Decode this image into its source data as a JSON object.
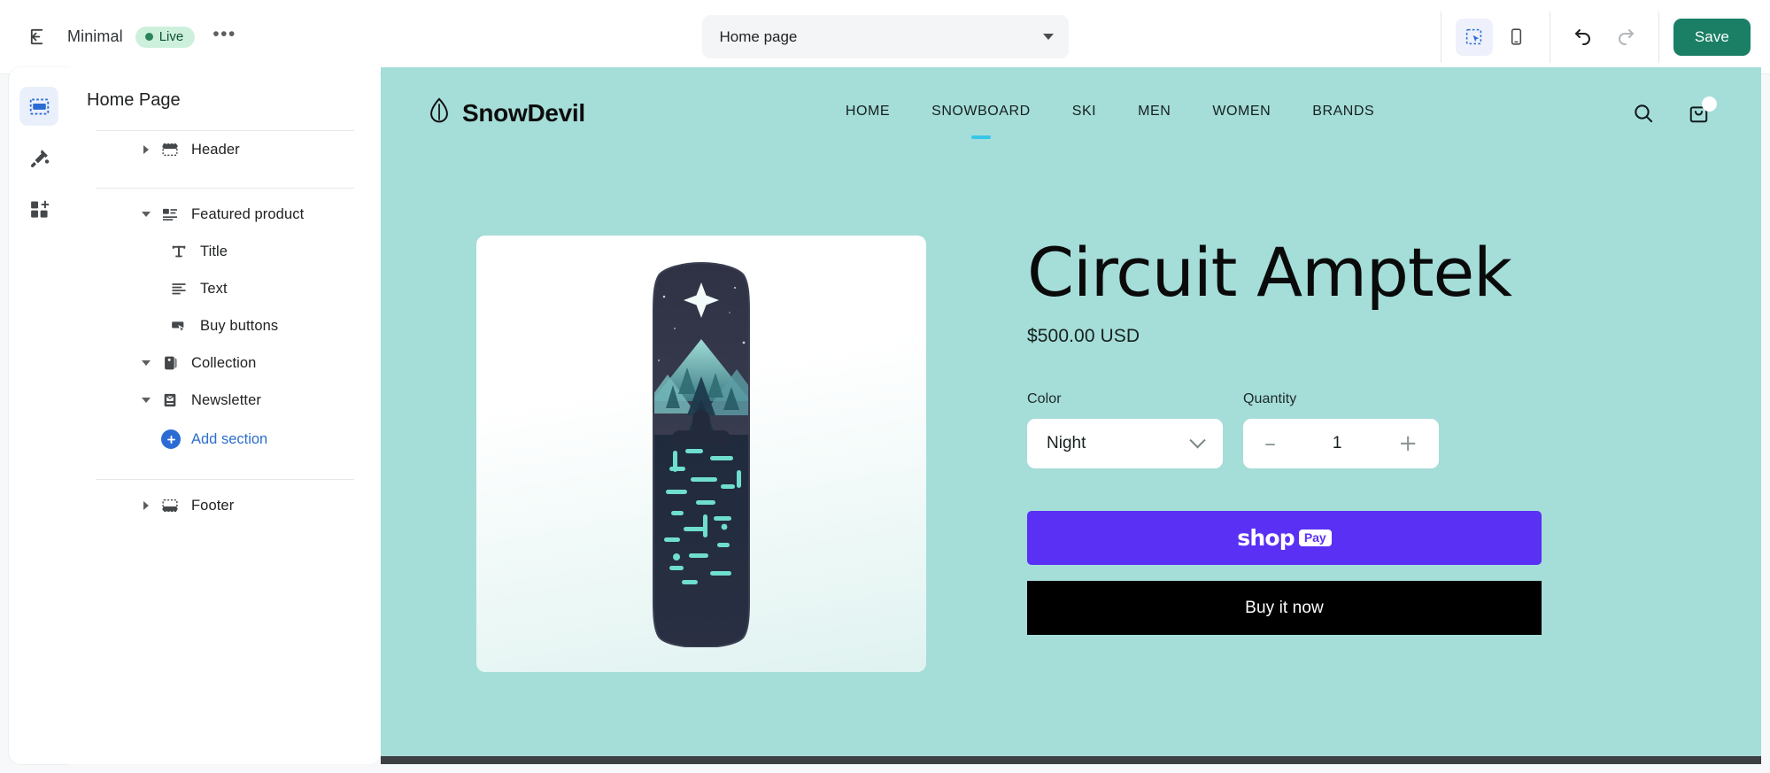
{
  "topbar": {
    "back_icon": "exit-to-app-icon",
    "theme_name": "Minimal",
    "live_badge": "Live",
    "more_menu": "•••",
    "page_selector": {
      "value": "Home page",
      "options": [
        "Home page"
      ],
      "caret_icon": "chevron-down-icon"
    },
    "view_desktop_icon": "desktop-select-icon",
    "view_mobile_icon": "mobile-icon",
    "undo_icon": "undo-icon",
    "redo_icon": "redo-icon",
    "save_label": "Save",
    "save_color": "#1a7f64"
  },
  "rail": {
    "items": [
      {
        "name": "sections",
        "icon": "sections-icon",
        "active": true
      },
      {
        "name": "theme-settings",
        "icon": "paintbrush-icon",
        "active": false
      },
      {
        "name": "app-embeds",
        "icon": "apps-blocks-icon",
        "active": false
      }
    ]
  },
  "sidebar": {
    "title": "Home Page",
    "header_group": [
      {
        "label": "Header",
        "icon": "header-section-icon",
        "expanded": false,
        "child": false
      }
    ],
    "body_group": [
      {
        "label": "Featured product",
        "icon": "featured-product-icon",
        "expanded": true,
        "child": false
      },
      {
        "label": "Title",
        "icon": "text-title-icon",
        "expanded": null,
        "child": true
      },
      {
        "label": "Text",
        "icon": "paragraph-text-icon",
        "expanded": null,
        "child": true
      },
      {
        "label": "Buy buttons",
        "icon": "buy-button-icon",
        "expanded": null,
        "child": true
      },
      {
        "label": "Collection",
        "icon": "collection-tag-icon",
        "expanded": true,
        "child": false
      },
      {
        "label": "Newsletter",
        "icon": "newsletter-icon",
        "expanded": true,
        "child": false
      }
    ],
    "add_section": {
      "label": "Add section",
      "icon": "plus-circle-icon",
      "color": "#2c6ecb"
    },
    "footer_group": [
      {
        "label": "Footer",
        "icon": "footer-section-icon",
        "expanded": false,
        "child": false
      }
    ]
  },
  "preview": {
    "background_color": "#a5ddd8",
    "store": {
      "brand": "SnowDevil",
      "brand_icon": "snowdevil-droplet-icon",
      "nav_links": [
        {
          "label": "HOME",
          "active": false
        },
        {
          "label": "SNOWBOARD",
          "active": true
        },
        {
          "label": "SKI",
          "active": false
        },
        {
          "label": "MEN",
          "active": false
        },
        {
          "label": "WOMEN",
          "active": false
        },
        {
          "label": "BRANDS",
          "active": false
        }
      ],
      "active_underline_color": "#36c6e8",
      "search_icon": "search-icon",
      "cart_icon": "shopping-bag-icon"
    },
    "product": {
      "image_alt": "snowboard-product-image",
      "title": "Circuit Amptek",
      "price": "$500.00 USD",
      "color_label": "Color",
      "color_value": "Night",
      "color_options": [
        "Night"
      ],
      "quantity_label": "Quantity",
      "quantity_value": "1",
      "quantity_minus": "–",
      "quantity_plus": "+",
      "shop_pay": {
        "word": "shop",
        "tag": "Pay",
        "color": "#5a31f4"
      },
      "buy_now_label": "Buy it now"
    }
  }
}
